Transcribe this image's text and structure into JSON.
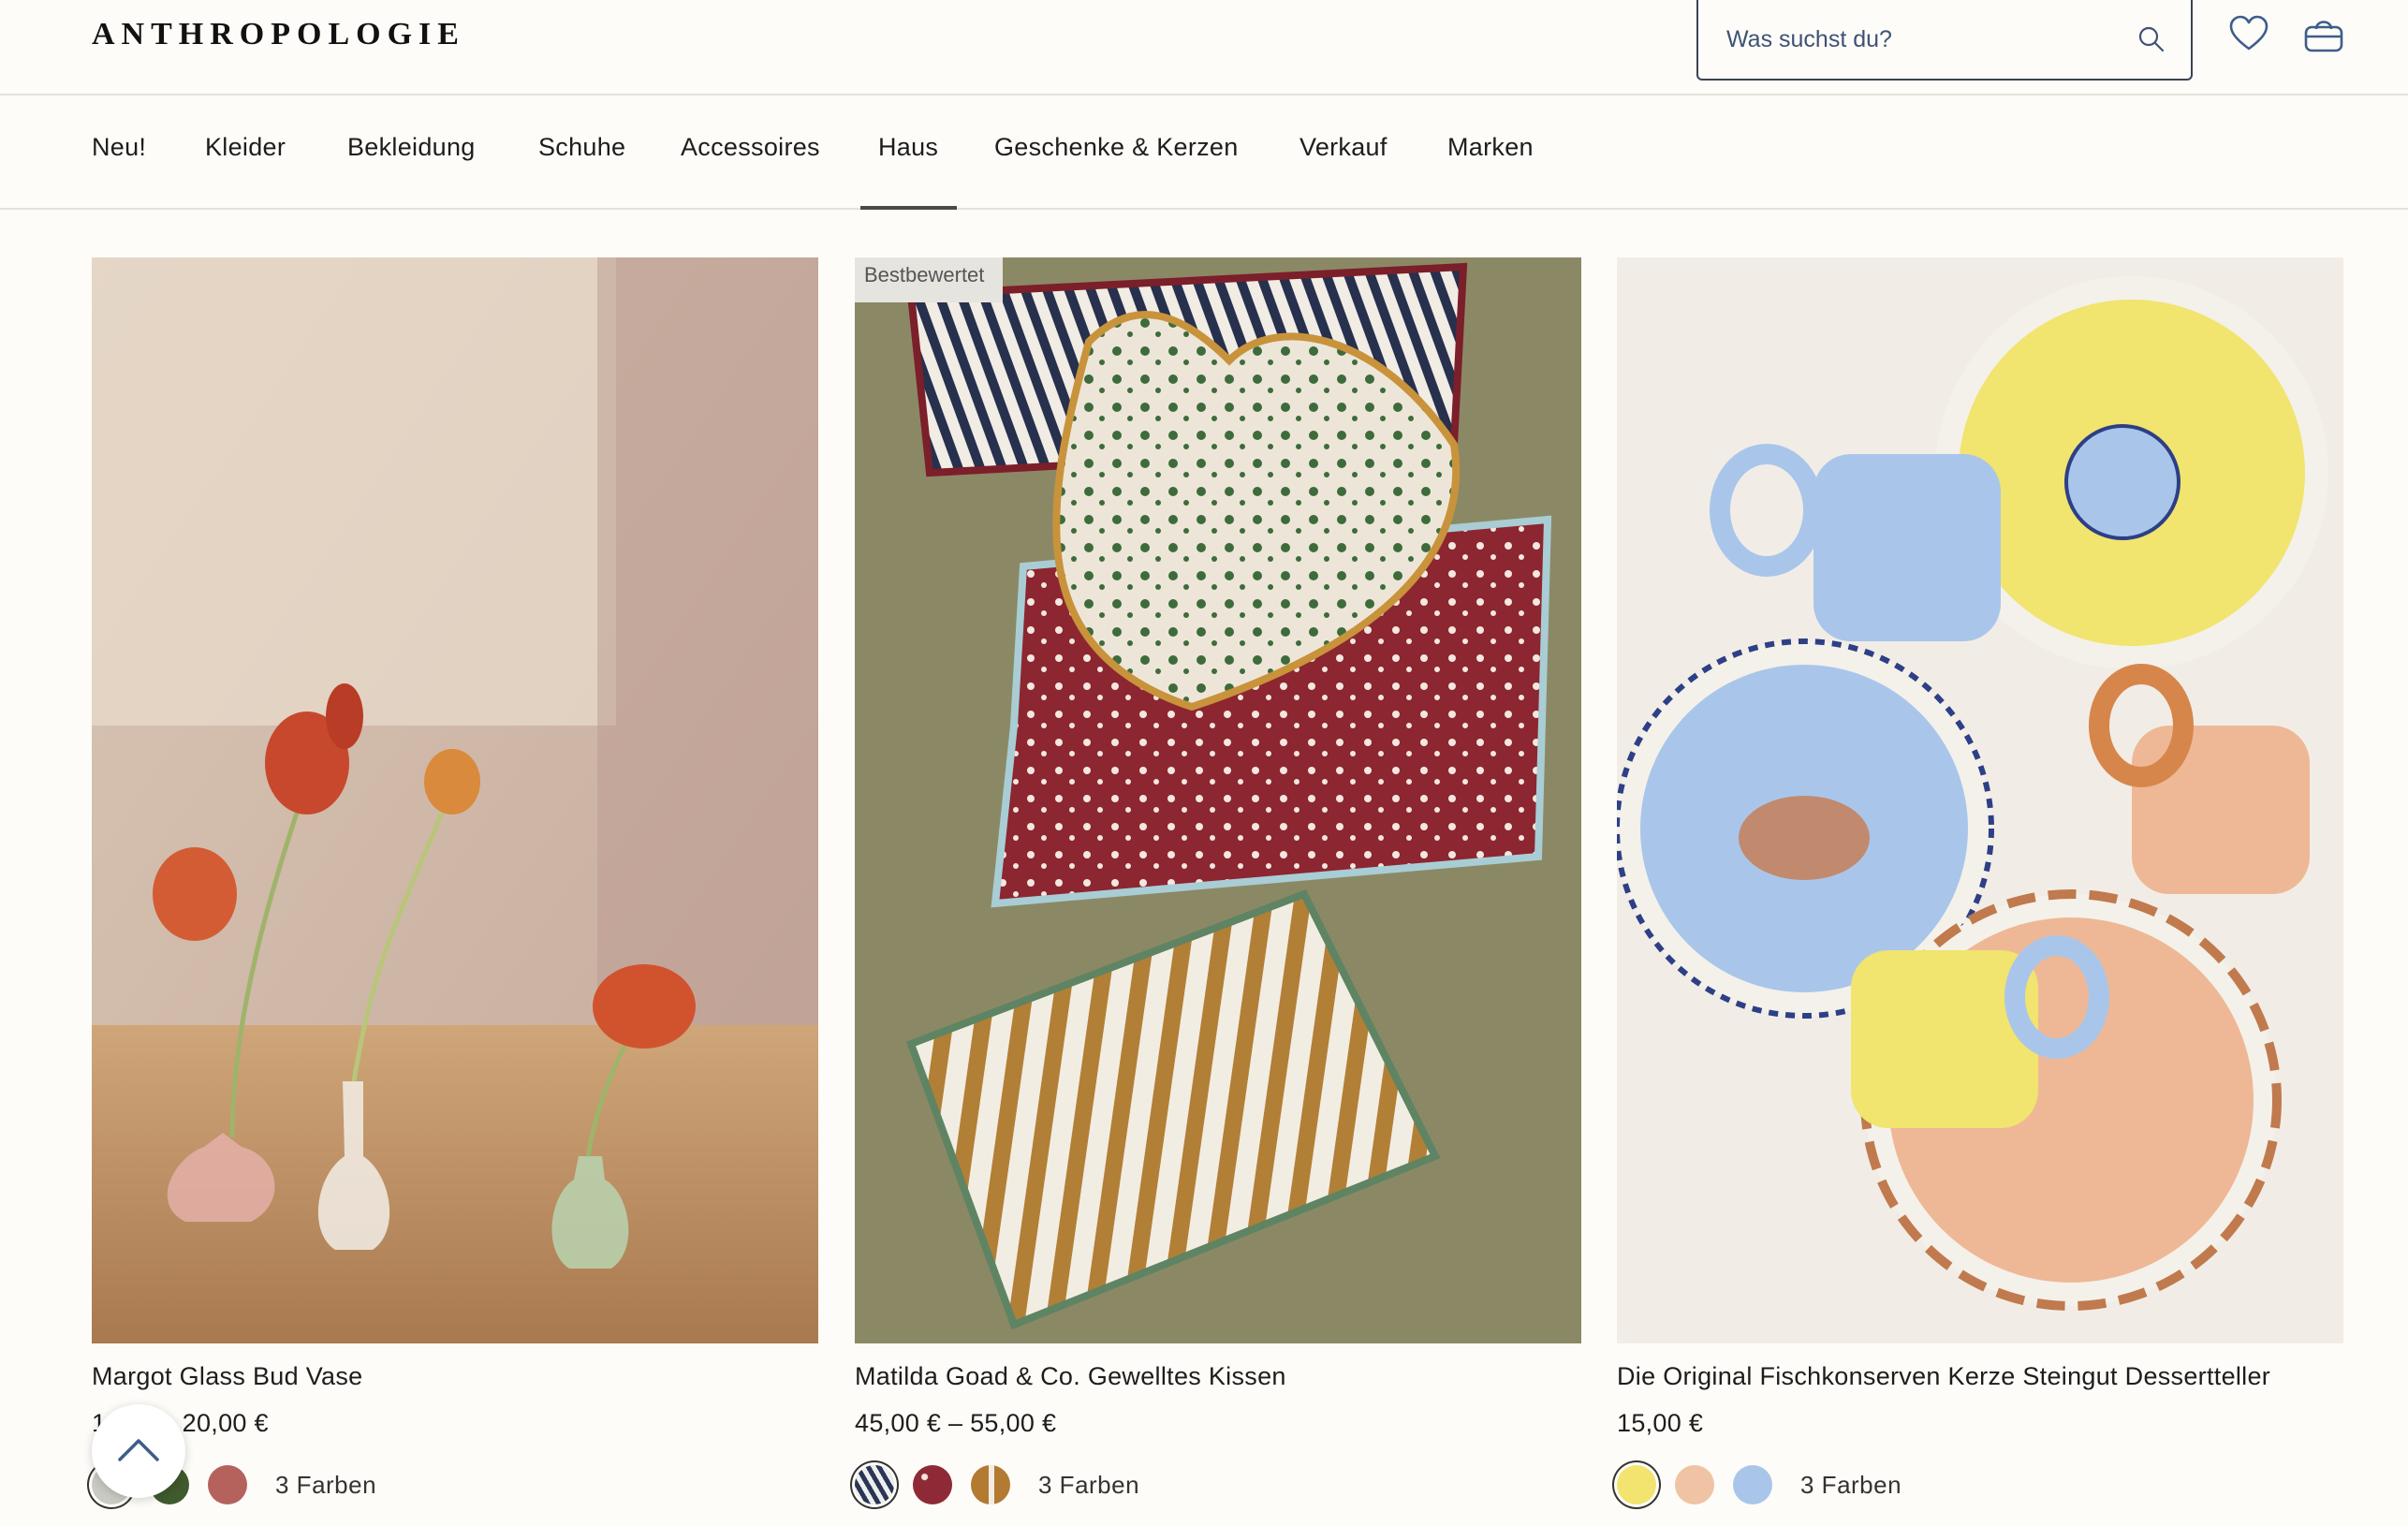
{
  "header": {
    "logo": "ANTHROPOLOGIE",
    "search_placeholder": "Was suchst du?"
  },
  "nav": {
    "items": [
      "Neu!",
      "Kleider",
      "Bekleidung",
      "Schuhe",
      "Accessoires",
      "Haus",
      "Geschenke & Kerzen",
      "Verkauf",
      "Marken"
    ],
    "active": "Haus"
  },
  "products": [
    {
      "name": "Margot Glass Bud Vase",
      "price": "1… € – 20,00 €",
      "swatch_colors": [
        "#c9cbc3",
        "#3f5a2c",
        "#b5625d"
      ],
      "colors_label": "3 Farben",
      "badge": ""
    },
    {
      "name": "Matilda Goad & Co. Gewelltes Kissen",
      "price": "45,00 € – 55,00 €",
      "swatch_colors": [
        "#2a3656",
        "#8e2a35",
        "#b37a32"
      ],
      "colors_label": "3 Farben",
      "badge": "Bestbewertet"
    },
    {
      "name": "Die Original Fischkonserven Kerze Steingut Dessertteller",
      "price": "15,00 €",
      "swatch_colors": [
        "#f2e46e",
        "#efc3a3",
        "#a9c6ea"
      ],
      "colors_label": "3 Farben",
      "badge": ""
    }
  ]
}
